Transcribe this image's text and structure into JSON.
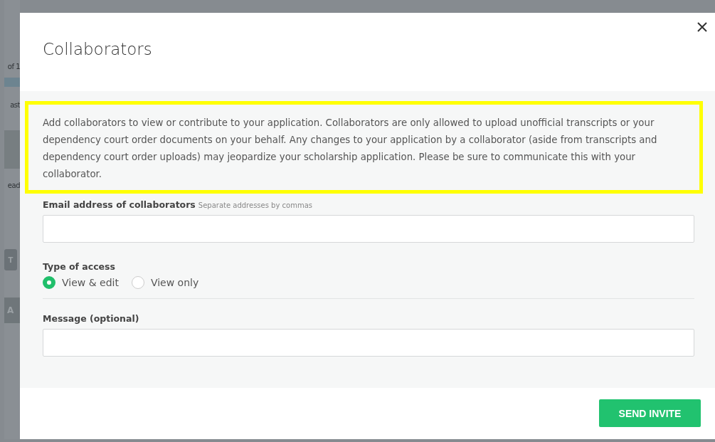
{
  "background_page": {
    "fragments": [
      "of 1",
      "ast",
      "ead"
    ],
    "buttons": [
      "T",
      "A"
    ]
  },
  "dialog": {
    "title": "Collaborators",
    "notice": "Add collaborators to view or contribute to your application. Collaborators are only allowed to upload unofficial transcripts or your dependency court order documents on your behalf. Any changes to your application by a collaborator (aside from transcripts and dependency court order uploads) may jeopardize your scholarship application. Please be sure to communicate this with your collaborator.",
    "email": {
      "label": "Email address of collaborators",
      "hint": "Separate addresses by commas"
    },
    "access": {
      "label": "Type of access",
      "options": [
        {
          "label": "View & edit",
          "selected": true
        },
        {
          "label": "View only",
          "selected": false
        }
      ]
    },
    "message": {
      "label": "Message (optional)"
    },
    "send_button": "SEND INVITE"
  }
}
